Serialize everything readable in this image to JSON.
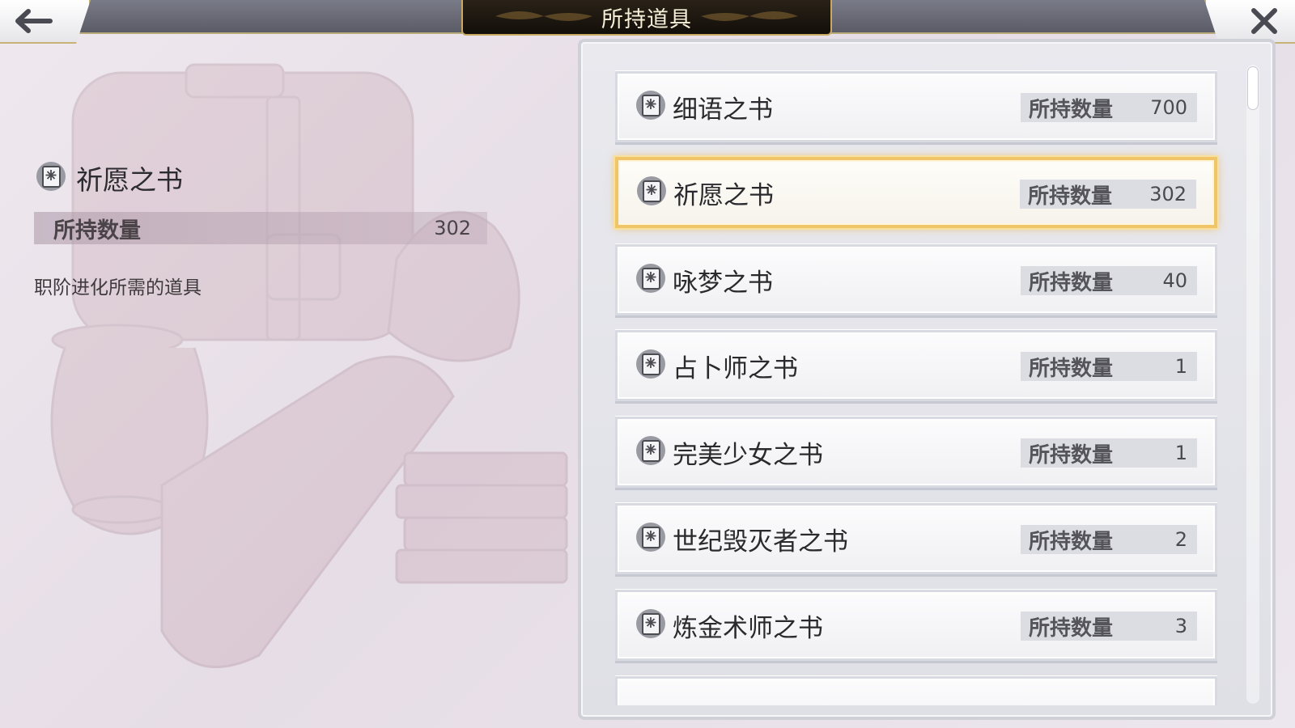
{
  "header": {
    "title": "所持道具",
    "back_icon": "arrow-left-icon",
    "close_icon": "close-x-icon"
  },
  "detail": {
    "icon": "book-icon",
    "name": "祈愿之书",
    "qty_label": "所持数量",
    "qty_value": "302",
    "description": "职阶进化所需的道具"
  },
  "items": [
    {
      "name": "细语之书",
      "qty_label": "所持数量",
      "qty": "700",
      "selected": false
    },
    {
      "name": "祈愿之书",
      "qty_label": "所持数量",
      "qty": "302",
      "selected": true
    },
    {
      "name": "咏梦之书",
      "qty_label": "所持数量",
      "qty": "40",
      "selected": false
    },
    {
      "name": "占卜师之书",
      "qty_label": "所持数量",
      "qty": "1",
      "selected": false
    },
    {
      "name": "完美少女之书",
      "qty_label": "所持数量",
      "qty": "1",
      "selected": false
    },
    {
      "name": "世纪毁灭者之书",
      "qty_label": "所持数量",
      "qty": "2",
      "selected": false
    },
    {
      "name": "炼金术师之书",
      "qty_label": "所持数量",
      "qty": "3",
      "selected": false
    }
  ],
  "colors": {
    "selected_border": "#f0c56a",
    "title_plate": "#1a140e",
    "frame_gold": "#c7a964"
  }
}
